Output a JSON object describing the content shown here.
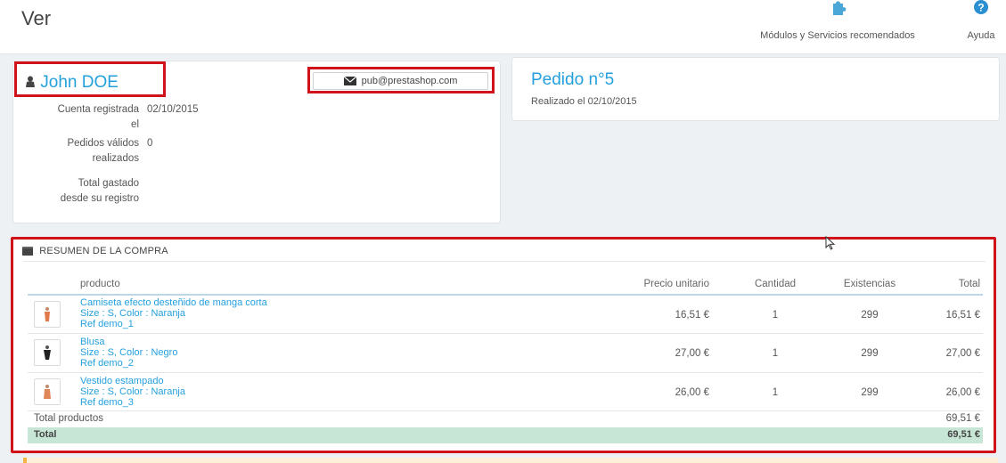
{
  "header": {
    "title": "Ver",
    "modules_label": "Módulos y Servicios recomendados",
    "help_label": "Ayuda"
  },
  "customer": {
    "name": "John DOE",
    "email": "pub@prestashop.com",
    "fields": [
      {
        "label_lines": [
          "Cuenta registrada",
          "el"
        ],
        "value": "02/10/2015"
      },
      {
        "label_lines": [
          "Pedidos válidos",
          "realizados"
        ],
        "value": "0"
      },
      {
        "label_lines": [
          "Total gastado",
          "desde su registro"
        ],
        "value": ""
      }
    ]
  },
  "order": {
    "title": "Pedido n°5",
    "subtitle": "Realizado el 02/10/2015"
  },
  "summary": {
    "heading": "RESUMEN DE LA COMPRA",
    "columns": [
      "producto",
      "Precio unitario",
      "Cantidad",
      "Existencias",
      "Total"
    ],
    "products": [
      {
        "name": "Camiseta efecto desteñido de manga corta",
        "attrs": "Size : S, Color : Naranja",
        "ref": "Ref demo_1",
        "price": "16,51 €",
        "qty": "1",
        "stock": "299",
        "total": "16,51 €",
        "thumb_color": "#e07a4a"
      },
      {
        "name": "Blusa",
        "attrs": "Size : S, Color : Negro",
        "ref": "Ref demo_2",
        "price": "27,00 €",
        "qty": "1",
        "stock": "299",
        "total": "27,00 €",
        "thumb_color": "#222222"
      },
      {
        "name": "Vestido estampado",
        "attrs": "Size : S, Color : Naranja",
        "ref": "Ref demo_3",
        "price": "26,00 €",
        "qty": "1",
        "stock": "299",
        "total": "26,00 €",
        "thumb_color": "#e0875a"
      }
    ],
    "total_products_label": "Total productos",
    "total_products_value": "69,51 €",
    "total_label": "Total",
    "total_value": "69,51 €"
  },
  "colors": {
    "accent": "#24a0dd",
    "highlight_red": "#d0121b",
    "total_row": "#c8e6d5"
  },
  "icons": [
    "puzzle-icon",
    "help-icon",
    "user-icon",
    "envelope-icon",
    "cart-icon",
    "cursor-icon"
  ]
}
